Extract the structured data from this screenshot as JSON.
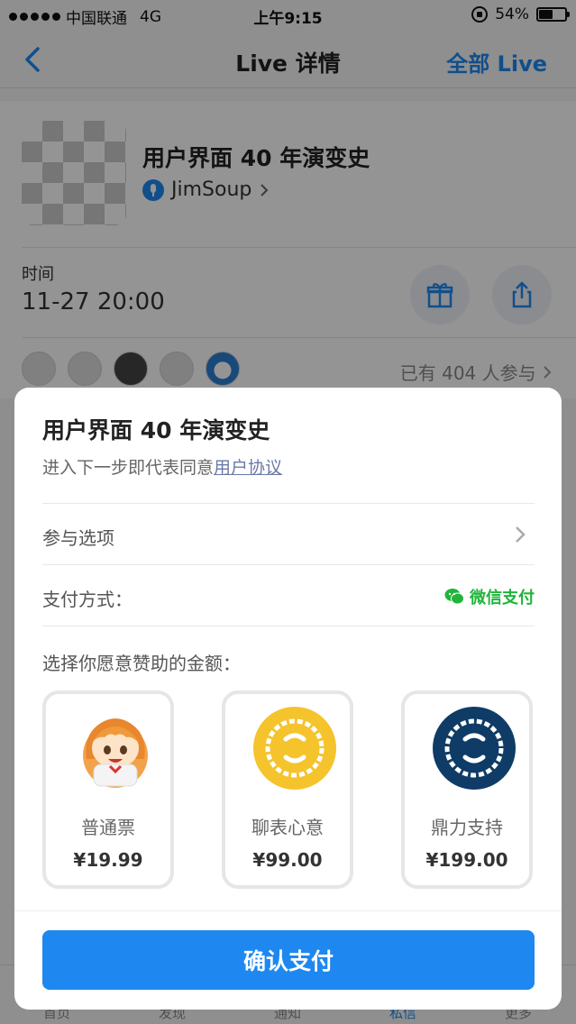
{
  "status_bar": {
    "carrier": "中国联通",
    "network": "4G",
    "time": "上午9:15",
    "battery_text": "54%",
    "battery_level": 0.54
  },
  "nav": {
    "title": "Live 详情",
    "right_label": "全部 Live",
    "back_icon": "chevron-left-icon"
  },
  "live": {
    "title": "用户界面 40 年演变史",
    "author": "JimSoup",
    "time_label": "时间",
    "time_value": "11-27 20:00",
    "participants": "已有 404 人参与"
  },
  "tab_bar": {
    "items": [
      "首页",
      "发现",
      "通知",
      "私信",
      "更多"
    ],
    "active_color": "#1e88f0"
  },
  "sheet": {
    "title": "用户界面 40 年演变史",
    "agree_prefix": "进入下一步即代表同意",
    "agree_link": "用户协议",
    "options_label": "参与选项",
    "payment_label": "支付方式：",
    "payment_method": "微信支付",
    "choose_label": "选择你愿意赞助的金额：",
    "tiers": [
      {
        "name": "普通票",
        "price": "¥19.99",
        "image": "anime-girl-avatar"
      },
      {
        "name": "聊表心意",
        "price": "¥99.00",
        "image": "yellow-badge-icon",
        "color": "#f5c32c"
      },
      {
        "name": "鼎力支持",
        "price": "¥199.00",
        "image": "navy-badge-icon",
        "color": "#0f3c66"
      }
    ],
    "confirm_label": "确认支付"
  },
  "colors": {
    "accent": "#1e88f0",
    "wechat_green": "#1fb53a",
    "link": "#6b78a8"
  }
}
